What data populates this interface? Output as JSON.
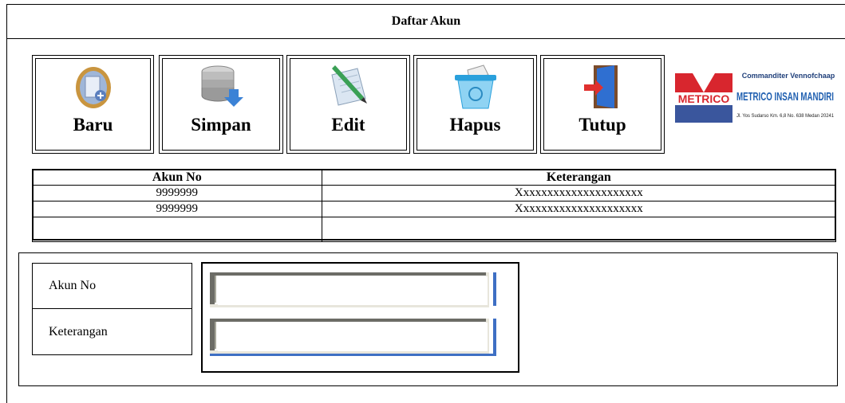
{
  "window": {
    "title": "Daftar Akun"
  },
  "toolbar": {
    "buttons": [
      {
        "label": "Baru",
        "icon": "new-document-icon"
      },
      {
        "label": "Simpan",
        "icon": "save-database-icon"
      },
      {
        "label": "Edit",
        "icon": "edit-pen-icon"
      },
      {
        "label": "Hapus",
        "icon": "recycle-bin-icon"
      },
      {
        "label": "Tutup",
        "icon": "exit-door-icon"
      }
    ]
  },
  "logo": {
    "brand_mark": "METRICO",
    "tagline": "Commanditer Vennofchaap",
    "company": "METRICO INSAN MANDIRI",
    "address": "Jl. Yos Sudarso Km. 6,8 No. 638 Medan 20241"
  },
  "table": {
    "columns": [
      "Akun No",
      "Keterangan"
    ],
    "rows": [
      [
        "9999999",
        "Xxxxxxxxxxxxxxxxxxxxx"
      ],
      [
        "9999999",
        "Xxxxxxxxxxxxxxxxxxxxx"
      ],
      [
        "",
        ""
      ]
    ]
  },
  "form": {
    "akun_no_label": "Akun No",
    "keterangan_label": "Keterangan",
    "akun_no_value": "",
    "keterangan_value": ""
  },
  "colors": {
    "accent_blue": "#3e6fc4",
    "logo_red": "#d8262e",
    "logo_blue": "#1f5fb0"
  }
}
